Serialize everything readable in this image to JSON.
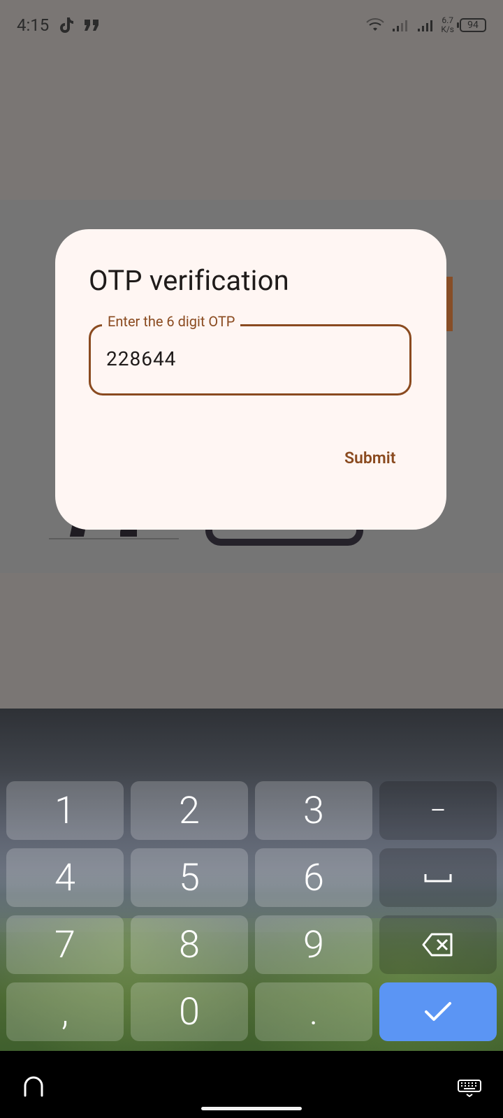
{
  "status_bar": {
    "time": "4:15",
    "speed_value": "6.7",
    "speed_unit": "K/s",
    "battery": "94",
    "icons": [
      "tiktok-icon",
      "quote-icon",
      "wifi-icon",
      "signal-icon",
      "signal-icon"
    ]
  },
  "dialog": {
    "title": "OTP verification",
    "otp_label": "Enter the 6 digit OTP",
    "otp_value": "228644",
    "submit_label": "Submit"
  },
  "keyboard": {
    "keys": [
      {
        "label": "1"
      },
      {
        "label": "2"
      },
      {
        "label": "3"
      },
      {
        "label": "−"
      },
      {
        "label": "4"
      },
      {
        "label": "5"
      },
      {
        "label": "6"
      },
      {
        "label": "␣"
      },
      {
        "label": "7"
      },
      {
        "label": "8"
      },
      {
        "label": "9"
      },
      {
        "label": "backspace"
      },
      {
        "label": ","
      },
      {
        "label": "0"
      },
      {
        "label": "."
      },
      {
        "label": "confirm"
      }
    ]
  },
  "nav_bar": {
    "left_icon": "keyboard-switch-icon",
    "right_icon": "keyboard-icon"
  },
  "colors": {
    "accent": "#8a4a1f",
    "dialog_bg": "#fff6f3",
    "confirm_key": "#5b95f4"
  }
}
